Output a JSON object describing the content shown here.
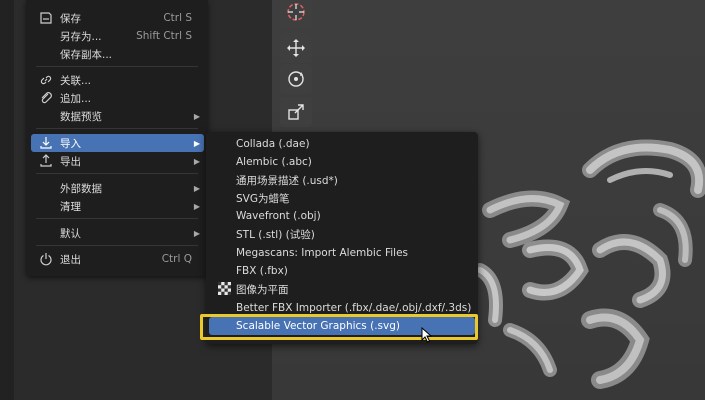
{
  "file_menu": {
    "items": [
      {
        "label": "保存",
        "shortcut": "Ctrl S",
        "icon": "save-icon"
      },
      {
        "label": "另存为...",
        "shortcut": "Shift Ctrl S"
      },
      {
        "label": "保存副本..."
      },
      {
        "label": "关联...",
        "icon": "link-icon"
      },
      {
        "label": "追加...",
        "icon": "append-icon"
      },
      {
        "label": "数据预览"
      },
      {
        "label": "导入",
        "icon": "import-icon",
        "state": "active"
      },
      {
        "label": "导出",
        "icon": "export-icon"
      },
      {
        "label": "外部数据"
      },
      {
        "label": "清理"
      },
      {
        "label": "默认"
      },
      {
        "label": "退出",
        "shortcut": "Ctrl Q",
        "icon": "power-icon"
      }
    ]
  },
  "import_submenu": {
    "items": [
      {
        "label": "Collada (.dae)"
      },
      {
        "label": "Alembic (.abc)"
      },
      {
        "label": "通用场景描述 (.usd*)"
      },
      {
        "label": "SVG为蜡笔"
      },
      {
        "label": "Wavefront (.obj)"
      },
      {
        "label": "STL (.stl) (试验)"
      },
      {
        "label": "Megascans: Import Alembic Files"
      },
      {
        "label": "FBX (.fbx)"
      },
      {
        "label": "图像为平面",
        "icon": "checker-image-icon"
      },
      {
        "label": "Better FBX Importer (.fbx/.dae/.obj/.dxf/.3ds)"
      },
      {
        "label": "Scalable Vector Graphics (.svg)",
        "state": "hovered"
      }
    ]
  },
  "toolbar": {
    "tools": [
      "cursor-target-icon",
      "move-icon",
      "rotate-icon",
      "scale-icon"
    ]
  },
  "colors": {
    "menu_bg": "#1e1e1e",
    "active_item": "#4772b3",
    "annotation_outline": "#e9c92c",
    "viewport_bg": "#3b3b3b"
  }
}
